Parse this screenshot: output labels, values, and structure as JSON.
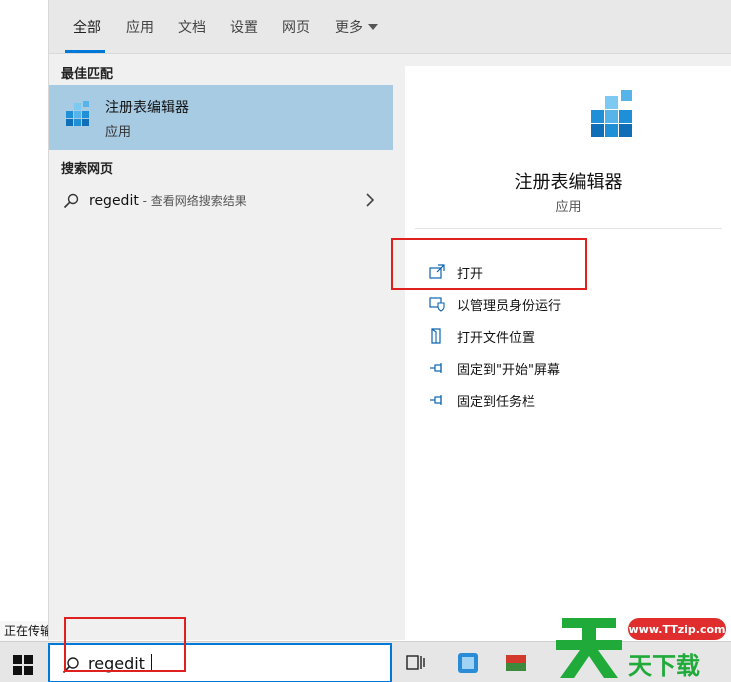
{
  "tabs": [
    {
      "label": "全部"
    },
    {
      "label": "应用"
    },
    {
      "label": "文档"
    },
    {
      "label": "设置"
    },
    {
      "label": "网页"
    },
    {
      "label": "更多"
    }
  ],
  "best_match": {
    "heading": "最佳匹配",
    "title": "注册表编辑器",
    "subtitle": "应用"
  },
  "web_search": {
    "heading": "搜索网页",
    "query": "regedit",
    "hint": " - 查看网络搜索结果"
  },
  "detail": {
    "title": "注册表编辑器",
    "subtitle": "应用",
    "actions": [
      {
        "label": "打开",
        "icon": "open-icon"
      },
      {
        "label": "以管理员身份运行",
        "icon": "shield-icon"
      },
      {
        "label": "打开文件位置",
        "icon": "file-location-icon"
      },
      {
        "label": "固定到\"开始\"屏幕",
        "icon": "pin-icon"
      },
      {
        "label": "固定到任务栏",
        "icon": "pin-icon"
      }
    ]
  },
  "status": "正在传输",
  "search_box": {
    "value": "regedit"
  },
  "watermark": {
    "brand": "天下载",
    "url": "www.TTzip.com"
  },
  "colors": {
    "accent": "#0078d7",
    "selection": "#a8cbe4",
    "highlight_box": "#e0201e"
  }
}
